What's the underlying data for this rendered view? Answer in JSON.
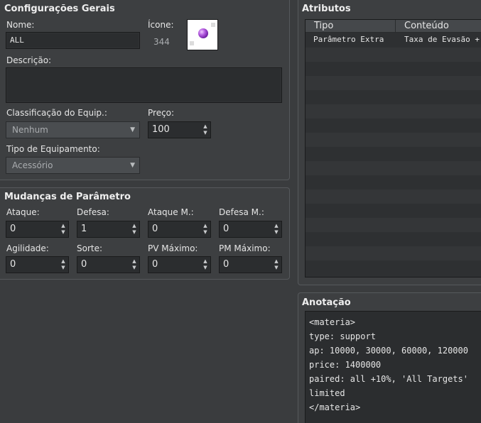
{
  "general": {
    "title": "Configurações Gerais",
    "name_label": "Nome:",
    "name_value": "ALL",
    "icon_label": "Ícone:",
    "icon_index": "344",
    "description_label": "Descrição:",
    "description_value": "",
    "equip_class_label": "Classificação do Equip.:",
    "equip_class_value": "Nenhum",
    "price_label": "Preço:",
    "price_value": "100",
    "equip_type_label": "Tipo de Equipamento:",
    "equip_type_value": "Acessório"
  },
  "params": {
    "title": "Mudanças de Parâmetro",
    "items": [
      {
        "label": "Ataque:",
        "value": "0"
      },
      {
        "label": "Defesa:",
        "value": "1"
      },
      {
        "label": "Ataque M.:",
        "value": "0"
      },
      {
        "label": "Defesa M.:",
        "value": "0"
      },
      {
        "label": "Agilidade:",
        "value": "0"
      },
      {
        "label": "Sorte:",
        "value": "0"
      },
      {
        "label": "PV Máximo:",
        "value": "0"
      },
      {
        "label": "PM Máximo:",
        "value": "0"
      }
    ]
  },
  "attributes": {
    "title": "Atributos",
    "col_type": "Tipo",
    "col_content": "Conteúdo",
    "rows": [
      {
        "type": "Parâmetro Extra",
        "content": "Taxa de Evasão +"
      }
    ]
  },
  "note": {
    "title": "Anotação",
    "text": "<materia>\ntype: support\nap: 10000, 30000, 60000, 120000\nprice: 1400000\npaired: all +10%, 'All Targets'\nlimited\n</materia>"
  }
}
